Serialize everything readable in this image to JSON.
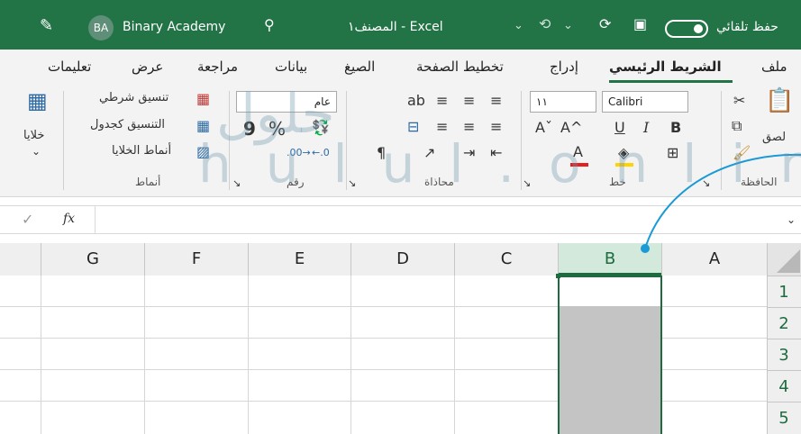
{
  "titlebar": {
    "autosave_label": "حفظ تلقائي",
    "file_name": "Excel - المصنف١",
    "user_initials": "BA",
    "user_name": "Binary Academy"
  },
  "tabs": [
    {
      "label": "ملف"
    },
    {
      "label": "الشريط الرئيسي",
      "active": true
    },
    {
      "label": "إدراج"
    },
    {
      "label": "تخطيط الصفحة"
    },
    {
      "label": "الصيغ"
    },
    {
      "label": "بيانات"
    },
    {
      "label": "مراجعة"
    },
    {
      "label": "عرض"
    },
    {
      "label": "تعليمات"
    }
  ],
  "ribbon": {
    "clipboard": {
      "label": "الحافظة",
      "paste_label": "لصق"
    },
    "font": {
      "label": "خط",
      "font_name": "Calibri",
      "font_size": "١١",
      "bold": "B",
      "italic": "I",
      "underline": "U",
      "grow": "A^",
      "shrink": "Aˇ",
      "color_letter": "A"
    },
    "alignment": {
      "label": "محاذاة"
    },
    "number": {
      "label": "رقم",
      "format": "عام",
      "percent": "%",
      "comma": "9",
      "inc_decimal": ".00\n→.0",
      "dec_decimal": "←.0\n.00"
    },
    "styles": {
      "label": "أنماط",
      "conditional": "تنسيق شرطي",
      "as_table": "التنسيق كجدول",
      "cell_styles": "أنماط الخلايا"
    },
    "cells": {
      "label": "خلايا"
    }
  },
  "formula_bar": {
    "fx": "fx",
    "value": ""
  },
  "grid": {
    "columns": [
      "A",
      "B",
      "C",
      "D",
      "E",
      "F",
      "G"
    ],
    "selected_column": "B",
    "rows": [
      "1",
      "2",
      "3",
      "4",
      "5"
    ]
  },
  "watermark": {
    "top": "حلول",
    "bottom": "hulul.online"
  },
  "colors": {
    "excel_green": "#227447",
    "selection_fill": "#c4c4c4",
    "callout_line": "#1a9ad6"
  }
}
